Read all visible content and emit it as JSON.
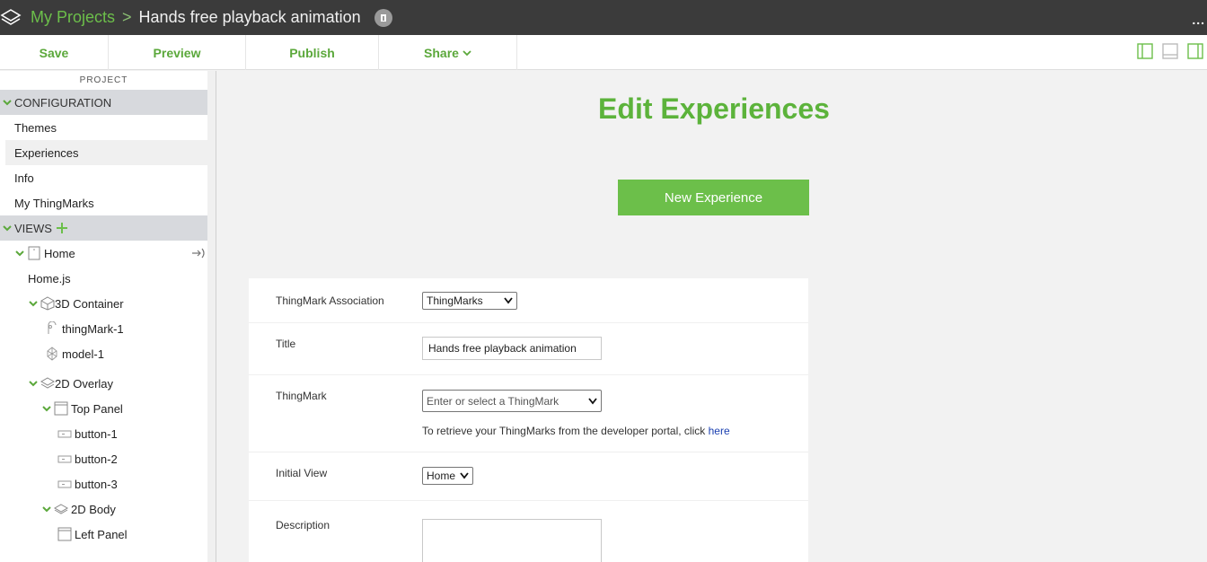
{
  "header": {
    "breadcrumb_link": "My Projects",
    "breadcrumb_sep": ">",
    "project_title": "Hands free playback animation",
    "more": "..."
  },
  "toolbar": {
    "save": "Save",
    "preview": "Preview",
    "publish": "Publish",
    "share": "Share"
  },
  "sidebar": {
    "project_label": "PROJECT",
    "configuration": {
      "label": "CONFIGURATION",
      "items": [
        "Themes",
        "Experiences",
        "Info",
        "My ThingMarks"
      ]
    },
    "views": {
      "label": "VIEWS",
      "tree": [
        "Home",
        "Home.js",
        "3D Container",
        "thingMark-1",
        "model-1",
        "2D Overlay",
        "Top Panel",
        "button-1",
        "button-2",
        "button-3",
        "2D Body",
        "Left Panel"
      ]
    }
  },
  "main": {
    "title": "Edit Experiences",
    "new_button": "New Experience",
    "form": {
      "thingmark_assoc_label": "ThingMark Association",
      "thingmark_assoc_value": "ThingMarks",
      "title_label": "Title",
      "title_value": "Hands free playback animation",
      "thingmark_label": "ThingMark",
      "thingmark_placeholder": "Enter or select a ThingMark",
      "thingmark_hint": "To retrieve your ThingMarks from the developer portal, click",
      "thingmark_hint_link": "here",
      "initial_view_label": "Initial View",
      "initial_view_value": "Home",
      "description_label": "Description",
      "description_value": ""
    }
  },
  "colors": {
    "accent": "#6cbf4a",
    "titlebar": "#3b3b3b",
    "section_bg": "#d7d9dd"
  }
}
